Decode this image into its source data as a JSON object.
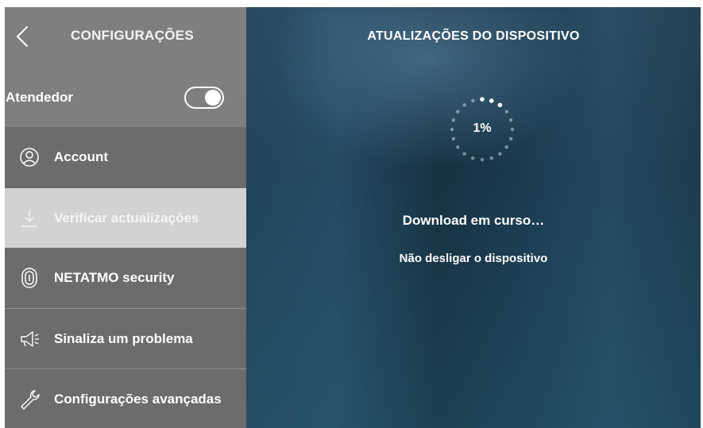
{
  "sidebar": {
    "title": "CONFIGURAÇÕES",
    "back_icon": "chevron-left-icon",
    "toggle_row": {
      "label": "Atendedor",
      "enabled": true
    },
    "items": [
      {
        "label": "Account",
        "icon": "user-circle-icon",
        "active": false
      },
      {
        "label": "Verificar actualizações",
        "icon": "download-icon",
        "active": true
      },
      {
        "label": "NETATMO security",
        "icon": "fingerprint-icon",
        "active": false
      },
      {
        "label": "Sinaliza um problema",
        "icon": "megaphone-icon",
        "active": false
      },
      {
        "label": "Configurações avançadas",
        "icon": "wrench-icon",
        "active": false
      }
    ]
  },
  "main": {
    "title": "ATUALIZAÇÕES DO DISPOSITIVO",
    "progress": {
      "value": 1,
      "label": "1%"
    },
    "status": "Download em curso…",
    "warning": "Não desligar o dispositivo"
  }
}
